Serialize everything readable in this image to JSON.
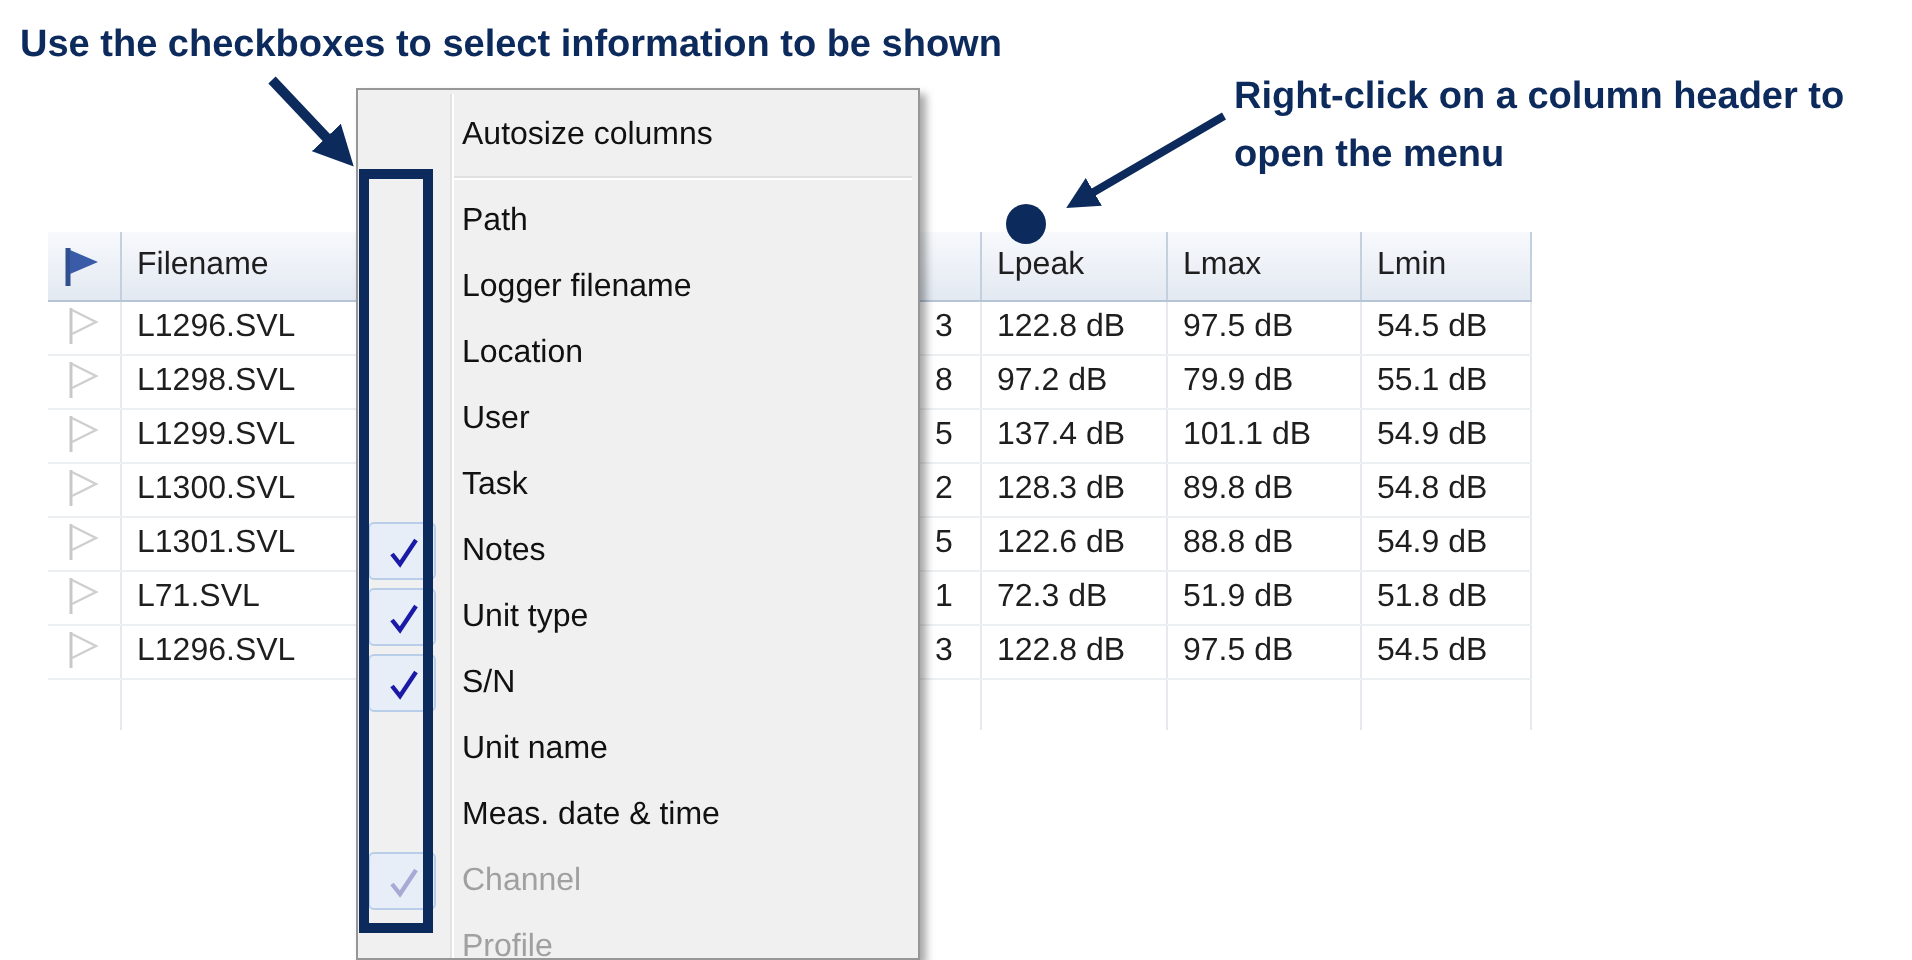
{
  "annotations": [
    {
      "kind": "title",
      "text": "Use the checkboxes to select information to be shown"
    },
    {
      "kind": "note",
      "text": "Right-click on a column header to open the menu"
    }
  ],
  "table": {
    "columns": [
      {
        "label": "Filename"
      },
      {},
      {
        "label": "Lpeak"
      },
      {
        "label": "Lmax"
      },
      {
        "label": "Lmin"
      }
    ],
    "rows": [
      [
        "L1296.SVL",
        "3",
        "122.8 dB",
        "97.5 dB",
        "54.5 dB"
      ],
      [
        "L1298.SVL",
        "8",
        "97.2 dB",
        "79.9 dB",
        "55.1 dB"
      ],
      [
        "L1299.SVL",
        "5",
        "137.4 dB",
        "101.1 dB",
        "54.9 dB"
      ],
      [
        "L1300.SVL",
        "2",
        "128.3 dB",
        "89.8 dB",
        "54.8 dB"
      ],
      [
        "L1301.SVL",
        "5",
        "122.6 dB",
        "88.8 dB",
        "54.9 dB"
      ],
      [
        "L71.SVL",
        "1",
        "72.3 dB",
        "51.9 dB",
        "51.8 dB"
      ],
      [
        "L1296.SVL",
        "3",
        "122.8 dB",
        "97.5 dB",
        "54.5 dB"
      ]
    ]
  },
  "context_menu": {
    "top_item": "Autosize columns",
    "items": [
      {
        "label": "Path",
        "checked": false,
        "disabled": false
      },
      {
        "label": "Logger filename",
        "checked": false,
        "disabled": false
      },
      {
        "label": "Location",
        "checked": false,
        "disabled": false
      },
      {
        "label": "User",
        "checked": false,
        "disabled": false
      },
      {
        "label": "Task",
        "checked": false,
        "disabled": false
      },
      {
        "label": "Notes",
        "checked": true,
        "disabled": false
      },
      {
        "label": "Unit type",
        "checked": true,
        "disabled": false
      },
      {
        "label": "S/N",
        "checked": true,
        "disabled": false
      },
      {
        "label": "Unit name",
        "checked": false,
        "disabled": false
      },
      {
        "label": "Meas. date & time",
        "checked": false,
        "disabled": false
      },
      {
        "label": "Channel",
        "checked": true,
        "disabled": true
      },
      {
        "label": "Profile",
        "checked": false,
        "disabled": true
      }
    ]
  }
}
